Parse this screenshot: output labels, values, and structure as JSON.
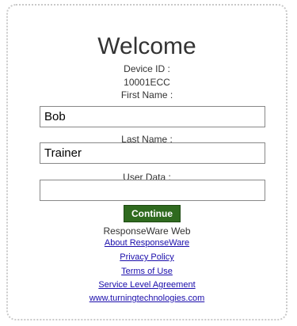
{
  "login": {
    "title": "Welcome",
    "device_id_label": "Device ID :",
    "device_id_value": "10001ECC",
    "first_name_label": "First Name :",
    "first_name_value": "Bob",
    "last_name_label": "Last Name :",
    "last_name_value": "Trainer",
    "user_data_label": "User Data :",
    "user_data_value": "",
    "continue_label": "Continue",
    "app_name": "ResponseWare Web"
  },
  "links": {
    "about": "About ResponseWare",
    "privacy": "Privacy Policy",
    "terms": "Terms of Use",
    "sla": "Service Level Agreement",
    "website": "www.turningtechnologies.com"
  },
  "colors": {
    "button_bg": "#2f6a1f",
    "link": "#1a0dab",
    "panel_border": "#c9c9c9"
  }
}
